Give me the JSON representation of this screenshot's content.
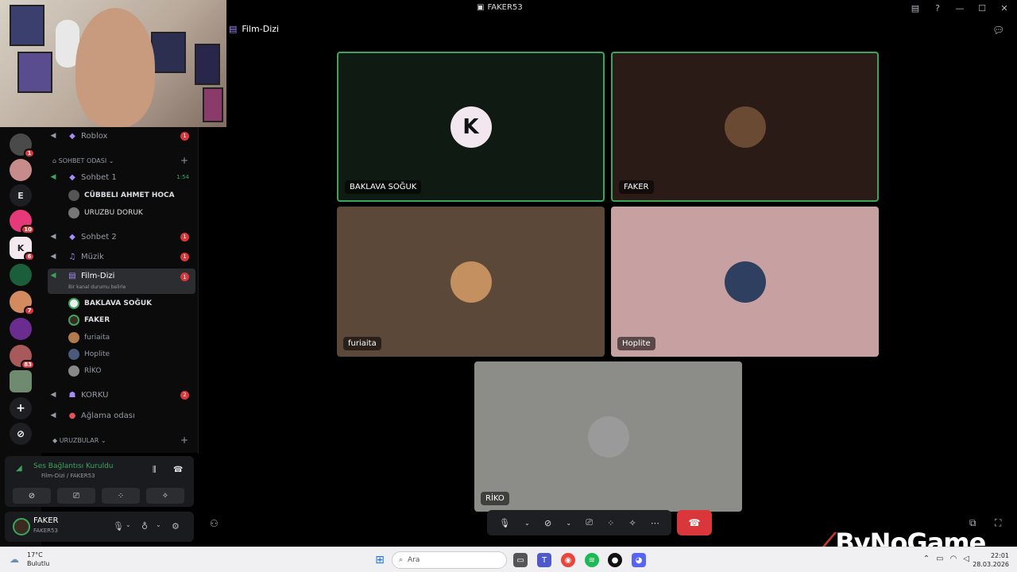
{
  "window": {
    "title": "FAKER53"
  },
  "header": {
    "channel": "Film-Dizi"
  },
  "rail": {
    "badges": [
      "1",
      "10",
      "6",
      "7",
      "83"
    ],
    "letter": "E"
  },
  "channels": {
    "top_item": {
      "label": "Roblox",
      "count": "1"
    },
    "category_sohbet": "SOHBET ODASI",
    "sohbet1": {
      "label": "Sohbet 1",
      "time": "1:54"
    },
    "sohbet1_members": [
      "CÜBBELI AHMET HOCA",
      "URUZBU DORUK"
    ],
    "sohbet2": {
      "label": "Sohbet 2",
      "count": "1"
    },
    "muzik": {
      "label": "Müzik",
      "count": "1"
    },
    "filmdizi": {
      "label": "Film-Dizi",
      "count": "1",
      "status": "Bir kanal durumu belirle"
    },
    "filmdizi_members": [
      "BAKLAVA SOĞUK",
      "FAKER",
      "furiaita",
      "Hoplite",
      "RİKO"
    ],
    "korku": {
      "label": "KORKU",
      "count": "2"
    },
    "aglama": {
      "label": "Ağlama odası"
    },
    "category_uruzbular": "URUZBULAR"
  },
  "voice_panel": {
    "title": "Ses Bağlantısı Kuruldu",
    "subtitle": "Film-Dizi / FAKER53"
  },
  "user_panel": {
    "name": "FAKER",
    "status": "FAKER53"
  },
  "tiles": [
    {
      "name": "BAKLAVA SOĞUK",
      "bg": "#0f1a12",
      "speaking": true
    },
    {
      "name": "FAKER",
      "bg": "#2a1b17",
      "speaking": true
    },
    {
      "name": "furiaita",
      "bg": "#5b4838",
      "speaking": false
    },
    {
      "name": "Hoplite",
      "bg": "#c7a1a2",
      "speaking": false
    },
    {
      "name": "RİKO",
      "bg": "#8c8c88",
      "speaking": false
    }
  ],
  "brand": {
    "text": "ByNoGame"
  },
  "taskbar": {
    "weather_temp": "17°C",
    "weather_desc": "Bulutlu",
    "search_placeholder": "Ara",
    "time": "22:01",
    "date": "28.03.2026"
  },
  "colors": {
    "accent_green": "#3ba55d",
    "danger_red": "#da373c",
    "brand_purple": "#a78bfa"
  }
}
